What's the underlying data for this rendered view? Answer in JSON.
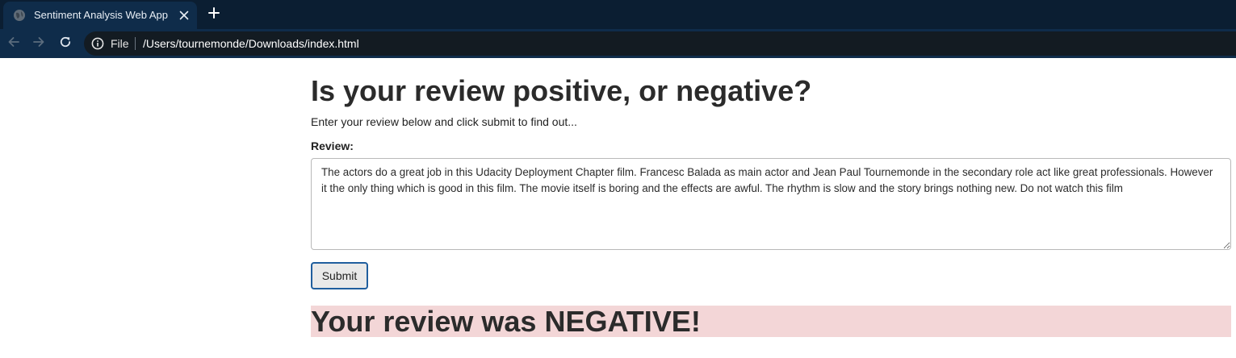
{
  "browser": {
    "tab": {
      "title": "Sentiment Analysis Web App"
    },
    "omnibox": {
      "scheme_label": "File",
      "url": "/Users/tournemonde/Downloads/index.html"
    },
    "colors": {
      "tabstrip": "#0b1e32",
      "toolbar": "#0f2c4a",
      "omnibox": "#131b22"
    },
    "icons": {
      "favicon": "globe-icon",
      "close": "close-icon",
      "new_tab": "plus-icon",
      "back": "arrow-left-icon",
      "forward": "arrow-right-icon",
      "reload": "reload-icon",
      "site_info": "info-icon"
    }
  },
  "page": {
    "title": "Is your review positive, or negative?",
    "lead": "Enter your review below and click submit to find out...",
    "form": {
      "review_label": "Review:",
      "review_value": "The actors do a great job in this Udacity Deployment Chapter film. Francesc Balada as main actor and Jean Paul Tournemonde in the secondary role act like great professionals. However it the only thing which is good in this film. The movie itself is boring and the effects are awful. The rhythm is slow and the story brings nothing new. Do not watch this film",
      "submit_label": "Submit"
    },
    "result": {
      "text": "Your review was NEGATIVE!",
      "background": "#f3d6d7"
    }
  }
}
